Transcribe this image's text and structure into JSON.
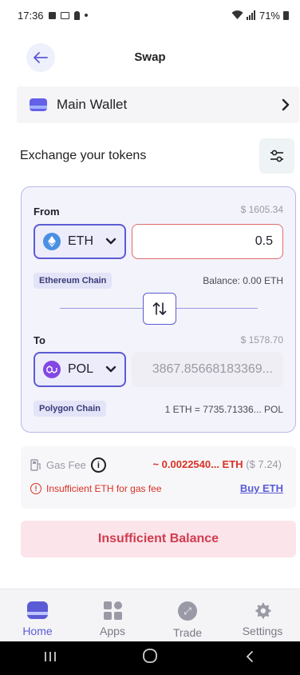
{
  "status_bar": {
    "time": "17:36",
    "battery": "71%"
  },
  "header": {
    "title": "Swap"
  },
  "wallet": {
    "name": "Main Wallet"
  },
  "exchange": {
    "title": "Exchange your tokens"
  },
  "from": {
    "label": "From",
    "usd_value": "$ 1605.34",
    "token": "ETH",
    "amount": "0.5",
    "chain": "Ethereum Chain",
    "balance": "Balance: 0.00 ETH"
  },
  "to": {
    "label": "To",
    "usd_value": "$ 1578.70",
    "token": "POL",
    "amount": "3867.85668183369...",
    "chain": "Polygon Chain",
    "rate": "1 ETH = 7735.71336... POL"
  },
  "gas": {
    "label": "Gas Fee",
    "amount": "~ 0.0022540... ETH",
    "usd": "($ 7.24)",
    "warning": "Insufficient ETH for gas fee",
    "buy_label": "Buy ETH"
  },
  "action": {
    "label": "Insufficient Balance"
  },
  "nav": {
    "items": [
      {
        "label": "Home",
        "icon": "wallet-icon",
        "active": true
      },
      {
        "label": "Apps",
        "icon": "apps-grid-icon",
        "active": false
      },
      {
        "label": "Trade",
        "icon": "trade-icon",
        "active": false
      },
      {
        "label": "Settings",
        "icon": "gear-icon",
        "active": false
      }
    ]
  },
  "colors": {
    "accent": "#5b5bd6",
    "error": "#d93025",
    "action_bg": "#fbe4ea",
    "action_text": "#d23c4f"
  },
  "icons": {
    "status_left": [
      "image-icon",
      "mail-icon",
      "person-icon",
      "dot-icon"
    ],
    "status_right": [
      "wifi-icon",
      "signal-icon",
      "battery-icon"
    ],
    "android": [
      "recents-icon",
      "home-circle-icon",
      "back-chevron-icon"
    ]
  }
}
